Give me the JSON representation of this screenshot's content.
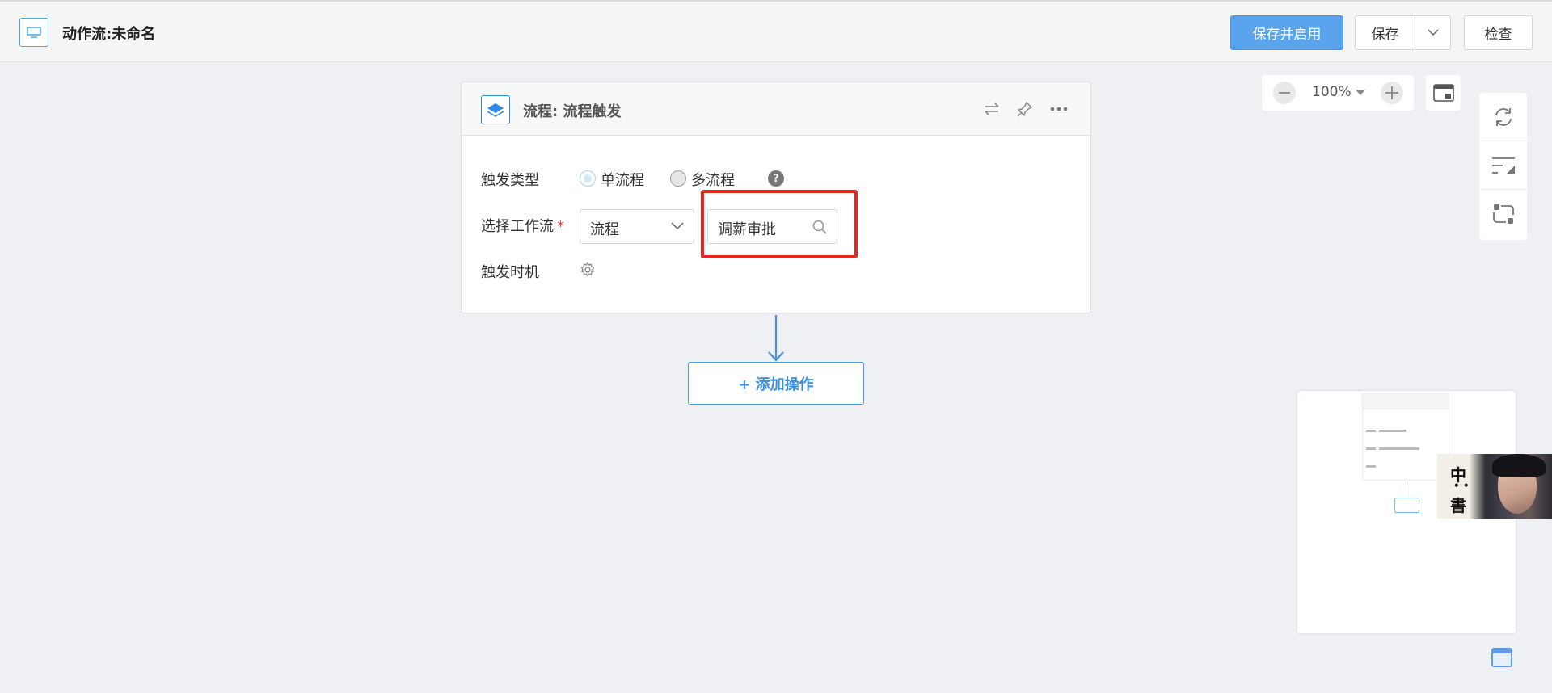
{
  "header": {
    "title": "动作流:未命名",
    "save_enable_label": "保存并启用",
    "save_label": "保存",
    "check_label": "检查"
  },
  "zoom": {
    "value": "100%"
  },
  "card": {
    "title": "流程: 流程触发",
    "trigger_type_label": "触发类型",
    "radio_single_label": "单流程",
    "radio_multi_label": "多流程",
    "select_workflow_label": "选择工作流",
    "required_mark": "*",
    "select_value": "流程",
    "search_value": "调薪审批",
    "trigger_timing_label": "触发时机",
    "help_symbol": "?"
  },
  "add_operation_label": "+ 添加操作",
  "colors": {
    "accent": "#5aa4ee",
    "highlight": "#e12a20",
    "required": "#e8453c"
  },
  "icons": {
    "app": "monitor-icon",
    "card": "layers-icon",
    "swap": "swap-icon",
    "pin": "pin-icon",
    "more": "more-icon",
    "gear": "gear-icon",
    "search": "search-icon",
    "refresh": "refresh-icon",
    "align": "align-icon",
    "connect": "connect-icon",
    "fullscreen": "fullscreen-icon"
  }
}
